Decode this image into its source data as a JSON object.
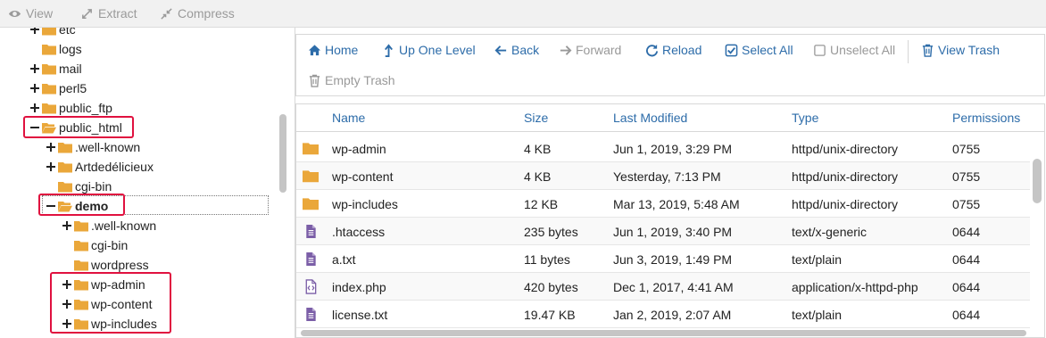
{
  "toolbar": {
    "view_label": "View",
    "view_icon": "eye-icon",
    "extract_label": "Extract",
    "extract_icon": "expand-arrows-icon",
    "compress_label": "Compress",
    "compress_icon": "compress-arrows-icon"
  },
  "tree": {
    "folder_color": "#eaa73a",
    "highlight_color": "#e0113f",
    "items": [
      {
        "label": "etc",
        "expander": "plus"
      },
      {
        "label": "logs",
        "expander": "none"
      },
      {
        "label": "mail",
        "expander": "plus"
      },
      {
        "label": "perl5",
        "expander": "plus"
      },
      {
        "label": "public_ftp",
        "expander": "plus"
      },
      {
        "label": "public_html",
        "expander": "minus",
        "open": true
      },
      {
        "label": ".well-known",
        "expander": "plus"
      },
      {
        "label": "Artdedélicieux",
        "expander": "plus"
      },
      {
        "label": "cgi-bin",
        "expander": "none"
      },
      {
        "label": "demo",
        "expander": "minus",
        "open": true,
        "selected": true
      },
      {
        "label": ".well-known",
        "expander": "plus"
      },
      {
        "label": "cgi-bin",
        "expander": "none"
      },
      {
        "label": "wordpress",
        "expander": "none"
      },
      {
        "label": "wp-admin",
        "expander": "plus"
      },
      {
        "label": "wp-content",
        "expander": "plus"
      },
      {
        "label": "wp-includes",
        "expander": "plus"
      }
    ]
  },
  "actions": {
    "home": "Home",
    "up_one_level": "Up One Level",
    "back": "Back",
    "forward": "Forward",
    "reload": "Reload",
    "select_all": "Select All",
    "unselect_all": "Unselect All",
    "view_trash": "View Trash",
    "empty_trash": "Empty Trash"
  },
  "table": {
    "headers": {
      "name": "Name",
      "size": "Size",
      "modified": "Last Modified",
      "type": "Type",
      "permissions": "Permissions"
    },
    "rows": [
      {
        "icon": "folder-icon",
        "name": "wp-admin",
        "size": "4 KB",
        "modified": "Jun 1, 2019, 3:29 PM",
        "type": "httpd/unix-directory",
        "perms": "0755"
      },
      {
        "icon": "folder-icon",
        "name": "wp-content",
        "size": "4 KB",
        "modified": "Yesterday, 7:13 PM",
        "type": "httpd/unix-directory",
        "perms": "0755"
      },
      {
        "icon": "folder-icon",
        "name": "wp-includes",
        "size": "12 KB",
        "modified": "Mar 13, 2019, 5:48 AM",
        "type": "httpd/unix-directory",
        "perms": "0755"
      },
      {
        "icon": "text-file-icon",
        "name": ".htaccess",
        "size": "235 bytes",
        "modified": "Jun 1, 2019, 3:40 PM",
        "type": "text/x-generic",
        "perms": "0644"
      },
      {
        "icon": "text-file-icon",
        "name": "a.txt",
        "size": "11 bytes",
        "modified": "Jun 3, 2019, 1:49 PM",
        "type": "text/plain",
        "perms": "0644"
      },
      {
        "icon": "code-file-icon",
        "name": "index.php",
        "size": "420 bytes",
        "modified": "Dec 1, 2017, 4:41 AM",
        "type": "application/x-httpd-php",
        "perms": "0644"
      },
      {
        "icon": "text-file-icon",
        "name": "license.txt",
        "size": "19.47 KB",
        "modified": "Jan 2, 2019, 2:07 AM",
        "type": "text/plain",
        "perms": "0644"
      }
    ]
  },
  "colors": {
    "link_blue": "#2d6ca9",
    "file_purple": "#7b5ea7"
  }
}
